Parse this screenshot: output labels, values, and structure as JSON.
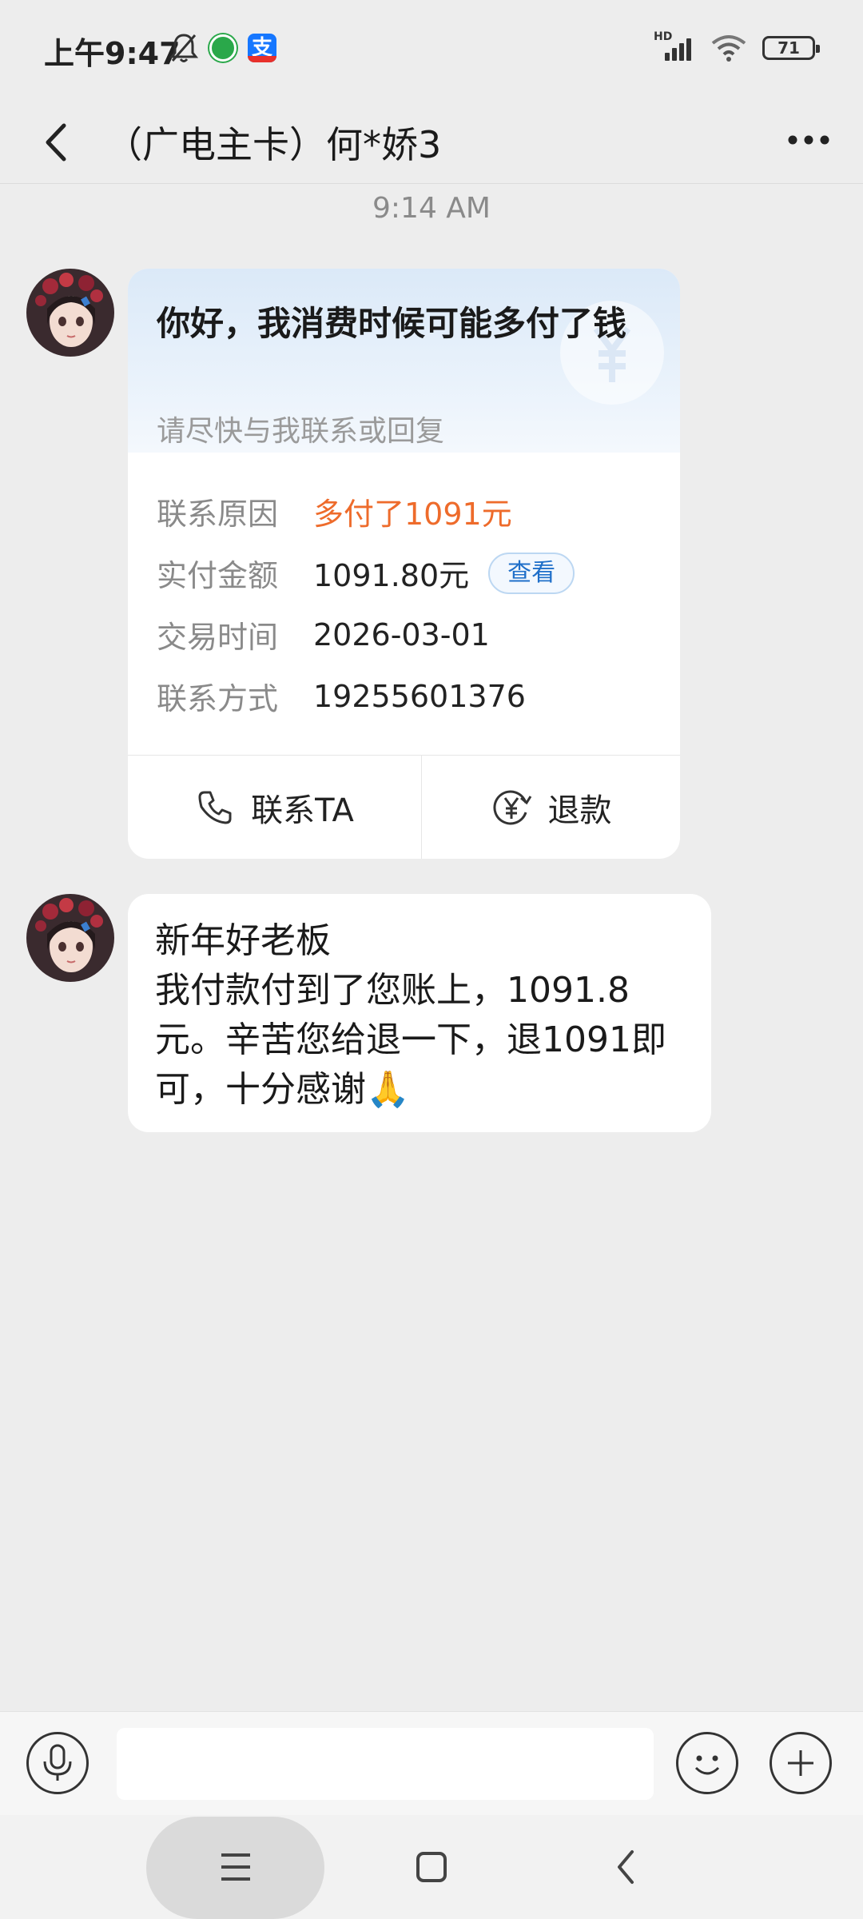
{
  "status_bar": {
    "time": "上午9:47",
    "signal_label": "HD",
    "battery": "71"
  },
  "header": {
    "title": "（广电主卡）何*娇3"
  },
  "chat": {
    "timestamp": "9:14 AM",
    "card": {
      "title": "你好，我消费时候可能多付了钱",
      "subtitle": "请尽快与我联系或回复",
      "rows": [
        {
          "label": "联系原因",
          "value": "多付了1091元"
        },
        {
          "label": "实付金额",
          "value": "1091.80元",
          "button": "查看"
        },
        {
          "label": "交易时间",
          "value": "2026-03-01"
        },
        {
          "label": "联系方式",
          "value": "19255601376"
        }
      ],
      "actions": {
        "contact": "联系TA",
        "refund": "退款"
      }
    },
    "message": {
      "lines": [
        "新年好老板",
        "我付款付到了您账上，1091.8",
        "元。辛苦您给退一下，退1091即",
        "可，十分感谢🙏"
      ]
    }
  },
  "input_bar": {
    "placeholder": ""
  },
  "colors": {
    "accent_orange": "#ee6b2b",
    "link_blue": "#1f6fc9",
    "background": "#ededed"
  }
}
